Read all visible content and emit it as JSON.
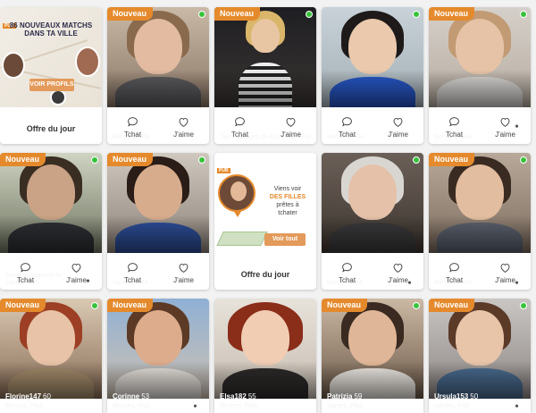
{
  "badge_label": "Nouveau",
  "actions": {
    "chat": "Tchat",
    "like": "J'aime"
  },
  "colors": {
    "accent": "#e58a2c",
    "online": "#37c23a"
  },
  "promo1": {
    "badge": "PUB",
    "title": "86 NOUVEAUX MATCHS DANS TA VILLE",
    "button": "VOIR PROFILS",
    "label": "Offre du jour"
  },
  "promo2": {
    "badge": "PUB",
    "line1": "Viens voir",
    "line2": "DES FILLES",
    "line3": "prêtes à",
    "line4": "tchater",
    "button": "Voir tout",
    "label": "Offre du jour"
  },
  "profiles": [
    {
      "name": "Marie",
      "age": "56",
      "location": "Rennes, FRA",
      "photos": ""
    },
    {
      "name": "Waltzresldzr",
      "age": "61",
      "location": "Saint-Jacques-de-la-Lande, FRA",
      "photos": ""
    },
    {
      "name": "Hocuu1f",
      "age": "52",
      "location": "Rennes, FRA",
      "photos": ""
    },
    {
      "name": "Sonia",
      "age": "54",
      "location": "Rennes, FRA",
      "photos": "3"
    },
    {
      "name": "Stephanie",
      "age": "40",
      "location": "Saint-Jacques-de-la-Lande, FRA",
      "photos": "5"
    },
    {
      "name": "zootm1h",
      "age": "51",
      "location": "Nantes, FRA",
      "photos": ""
    },
    {
      "name": "dhrd03h",
      "age": "45",
      "location": "Nantes, FRA",
      "photos": "2"
    },
    {
      "name": "Sylvia",
      "age": "60",
      "location": "Rennes, FRA",
      "photos": "4"
    },
    {
      "name": "Florine147",
      "age": "60",
      "location": "Rennes, FRA",
      "photos": ""
    },
    {
      "name": "Corinne",
      "age": "53",
      "location": "Rennes, FRA",
      "photos": "2"
    },
    {
      "name": "Elsa182",
      "age": "55",
      "location": "Rennes, FRA",
      "photos": ""
    },
    {
      "name": "Patrizia",
      "age": "59",
      "location": "Nantes, FRA",
      "photos": ""
    },
    {
      "name": "Ursula153",
      "age": "50",
      "location": "Nantes, FRA",
      "photos": "2"
    }
  ]
}
